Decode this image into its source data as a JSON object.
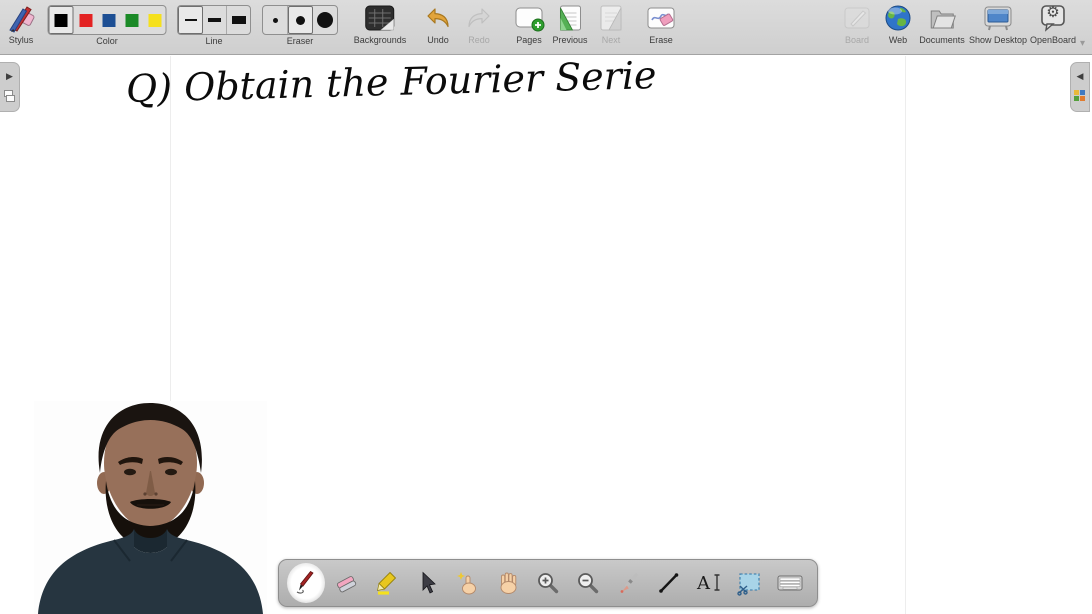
{
  "app": {
    "name": "OpenBoard whiteboard"
  },
  "icons": {
    "gear": "⚙",
    "triangle_right": "▶",
    "triangle_left": "◀",
    "chevron_down": "▾"
  },
  "top_toolbar": {
    "stylus": {
      "label": "Stylus"
    },
    "color": {
      "label": "Color",
      "swatches": [
        "#000000",
        "#e32222",
        "#1d4f94",
        "#1b8a27",
        "#f5e01d"
      ],
      "selected_index": 0
    },
    "line": {
      "label": "Line",
      "options": [
        "thin",
        "medium",
        "thick"
      ],
      "selected_index": 0
    },
    "eraser": {
      "label": "Eraser",
      "options": [
        "small",
        "medium",
        "large"
      ],
      "selected_index": 1
    },
    "backgrounds": {
      "label": "Backgrounds"
    },
    "undo": {
      "label": "Undo",
      "enabled": true
    },
    "redo": {
      "label": "Redo",
      "enabled": false
    },
    "pages": {
      "label": "Pages"
    },
    "previous": {
      "label": "Previous",
      "enabled": true
    },
    "next": {
      "label": "Next",
      "enabled": false
    },
    "erase": {
      "label": "Erase"
    },
    "board": {
      "label": "Board",
      "enabled": false
    },
    "web": {
      "label": "Web"
    },
    "documents": {
      "label": "Documents"
    },
    "show_desktop": {
      "label": "Show Desktop"
    },
    "openboard": {
      "label": "OpenBoard"
    }
  },
  "canvas": {
    "handwriting_text": "Q) Obtain the Fourier Serie",
    "ink_color": "#000000",
    "page_edge_color": "#ededed"
  },
  "stylus_palette": {
    "selected_tool": "pen",
    "tools": [
      "pen",
      "eraser",
      "highlighter",
      "selector",
      "interact",
      "pan",
      "zoom-in",
      "zoom-out",
      "laser-pointer",
      "line",
      "text",
      "capture",
      "keyboard"
    ]
  },
  "webcam_overlay": {
    "present": true,
    "position": "bottom-left"
  }
}
